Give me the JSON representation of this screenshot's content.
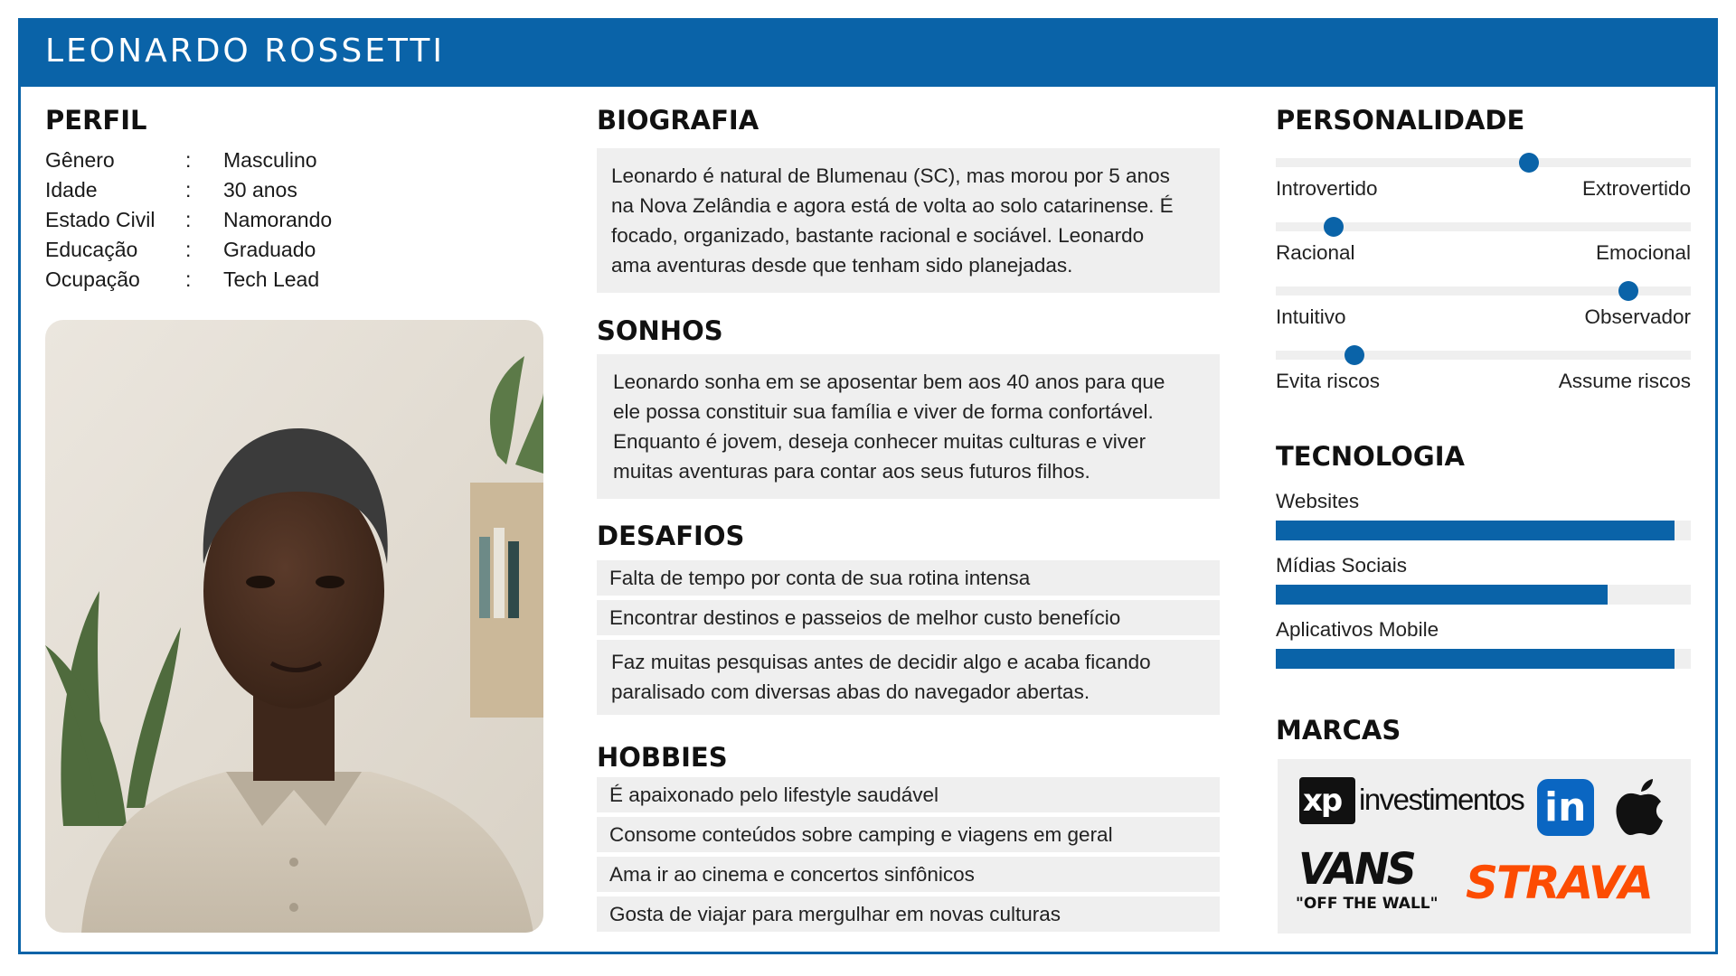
{
  "header": {
    "name": "LEONARDO ROSSETTI"
  },
  "perfil": {
    "title": "PERFIL",
    "rows": [
      {
        "key": "Gênero",
        "sep": ":",
        "value": "Masculino"
      },
      {
        "key": "Idade",
        "sep": ":",
        "value": "30 anos"
      },
      {
        "key": "Estado Civil",
        "sep": ":",
        "value": "Namorando"
      },
      {
        "key": "Educação",
        "sep": ":",
        "value": "Graduado"
      },
      {
        "key": "Ocupação",
        "sep": ":",
        "value": "Tech Lead"
      }
    ]
  },
  "biografia": {
    "title": "BIOGRAFIA",
    "lines": [
      "Leonardo é natural de Blumenau (SC), mas morou por 5 anos",
      "na Nova Zelândia e agora está de volta ao solo catarinense. É",
      "focado, organizado, bastante racional e sociável. Leonardo",
      "ama aventuras desde que tenham sido planejadas."
    ]
  },
  "sonhos": {
    "title": "SONHOS",
    "lines": [
      "Leonardo sonha em se aposentar bem aos 40 anos para que",
      "ele possa constituir sua família e viver de forma confortável.",
      "Enquanto é jovem, deseja conhecer muitas culturas e viver",
      "muitas aventuras para contar aos seus futuros filhos."
    ]
  },
  "desafios": {
    "title": "DESAFIOS",
    "items": [
      [
        "Falta de tempo por conta de sua rotina intensa"
      ],
      [
        "Encontrar destinos e passeios de melhor custo benefício"
      ],
      [
        "Faz muitas pesquisas antes de decidir algo e acaba ficando",
        "paralisado com diversas abas do navegador abertas."
      ]
    ]
  },
  "hobbies": {
    "title": "HOBBIES",
    "items": [
      "É apaixonado pelo lifestyle saudável",
      "Consome conteúdos sobre camping e viagens em geral",
      "Ama ir ao cinema e concertos sinfônicos",
      "Gosta de viajar para mergulhar em novas culturas"
    ]
  },
  "personalidade": {
    "title": "PERSONALIDADE",
    "traits": [
      {
        "left": "Introvertido",
        "right": "Extrovertido",
        "value": 0.61
      },
      {
        "left": "Racional",
        "right": "Emocional",
        "value": 0.14
      },
      {
        "left": "Intuitivo",
        "right": "Observador",
        "value": 0.85
      },
      {
        "left": "Evita riscos",
        "right": "Assume riscos",
        "value": 0.19
      }
    ]
  },
  "tecnologia": {
    "title": "TECNOLOGIA",
    "items": [
      {
        "label": "Websites",
        "value": 0.96
      },
      {
        "label": "Mídias Sociais",
        "value": 0.8
      },
      {
        "label": "Aplicativos Mobile",
        "value": 0.96
      }
    ]
  },
  "marcas": {
    "title": "MARCAS",
    "logos": [
      {
        "name": "xp-investimentos-logo",
        "text": "xp investimentos"
      },
      {
        "name": "linkedin-logo",
        "text": "in"
      },
      {
        "name": "apple-logo",
        "text": ""
      },
      {
        "name": "vans-logo",
        "text": "VANS \"OFF THE WALL\""
      },
      {
        "name": "strava-logo",
        "text": "STRAVA"
      }
    ]
  },
  "colors": {
    "primary": "#0a63a8",
    "panel": "#efefef",
    "strava": "#fc4c02"
  }
}
